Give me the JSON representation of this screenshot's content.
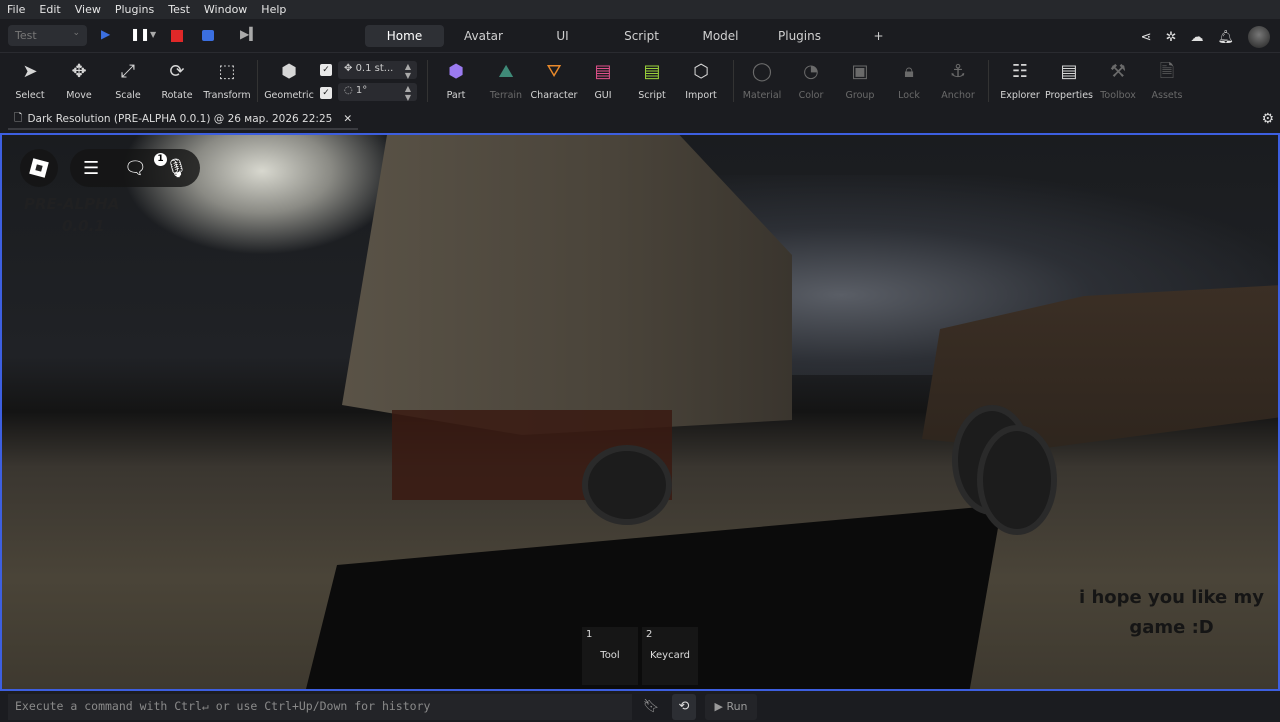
{
  "menu": [
    "File",
    "Edit",
    "View",
    "Plugins",
    "Test",
    "Window",
    "Help"
  ],
  "test_mode": "Test",
  "tabs": [
    "Home",
    "Avatar",
    "UI",
    "Script",
    "Model",
    "Plugins",
    "+"
  ],
  "tools": {
    "select": "Select",
    "move": "Move",
    "scale": "Scale",
    "rotate": "Rotate",
    "transform": "Transform",
    "geometric": "Geometric",
    "move_step": "0.1 st...",
    "rotate_step": "1°",
    "part": "Part",
    "terrain": "Terrain",
    "character": "Character",
    "gui": "GUI",
    "script": "Script",
    "import": "Import",
    "material": "Material",
    "color": "Color",
    "group": "Group",
    "lock": "Lock",
    "anchor": "Anchor",
    "explorer": "Explorer",
    "properties": "Properties",
    "toolbox": "Toolbox",
    "assets": "Assets"
  },
  "doc_tab": "Dark Resolution (PRE-ALPHA 0.0.1) @ 26 мар. 2026 22:25",
  "game": {
    "chat_badge": "1",
    "watermark_1": "PRE-ALPHA",
    "watermark_2": "0.0.1",
    "hotbar": [
      {
        "num": "1",
        "label": "Tool"
      },
      {
        "num": "2",
        "label": "Keycard"
      }
    ],
    "message_1": "i hope you like my",
    "message_2": "game :D"
  },
  "command": {
    "placeholder": "Execute a command with Ctrl↵ or use Ctrl+Up/Down for history",
    "run": "Run"
  }
}
